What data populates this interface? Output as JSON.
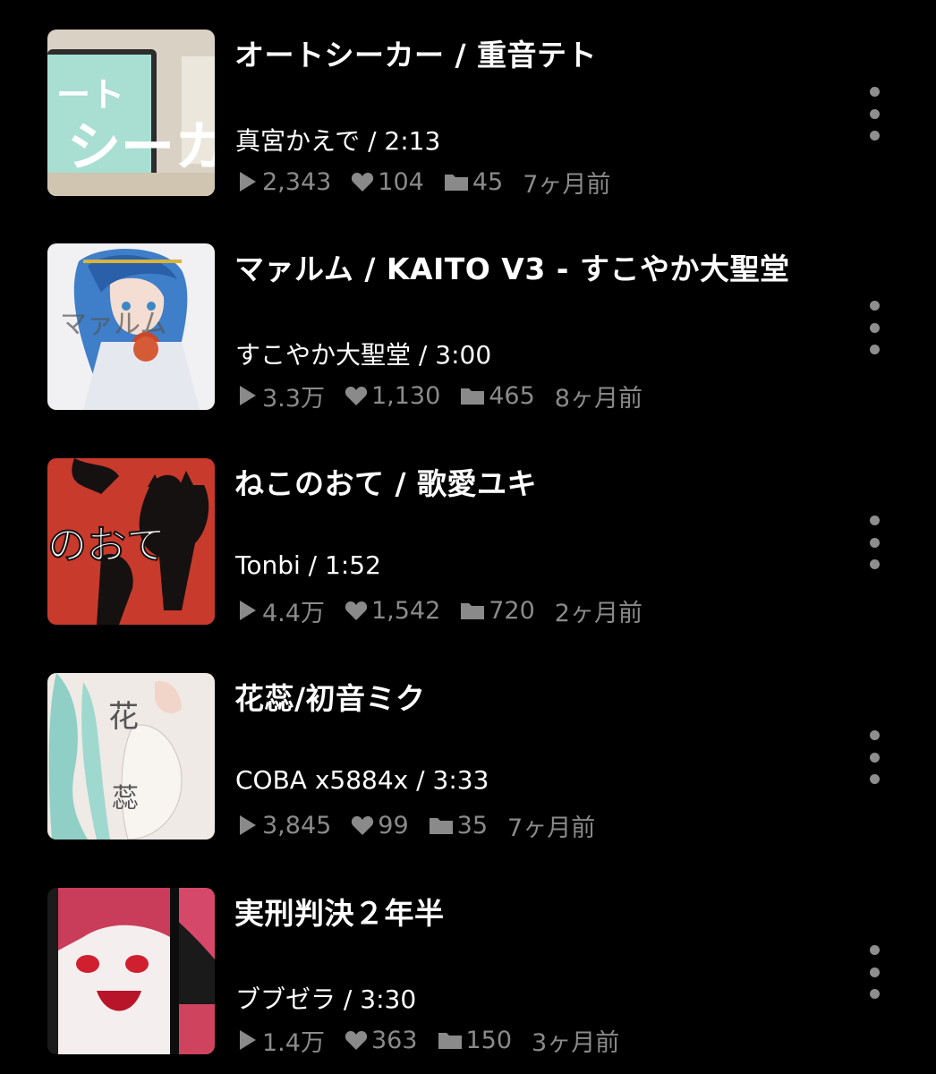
{
  "items": [
    {
      "title": "オートシーカー / 重音テト",
      "artist": "真宮かえで",
      "duration": "2:13",
      "plays": "2,343",
      "likes": "104",
      "mylists": "45",
      "age": "7ヶ月前",
      "thumb_text": "ートシーカ"
    },
    {
      "title": "マァルム / KAITO V3 - すこやか大聖堂",
      "artist": "すこやか大聖堂",
      "duration": "3:00",
      "plays": "3.3万",
      "likes": "1,130",
      "mylists": "465",
      "age": "8ヶ月前",
      "thumb_text": "マァルム"
    },
    {
      "title": "ねこのおて / 歌愛ユキ",
      "artist": "Tonbi",
      "duration": "1:52",
      "plays": "4.4万",
      "likes": "1,542",
      "mylists": "720",
      "age": "2ヶ月前",
      "thumb_text": "ねこのおて"
    },
    {
      "title": "花蕊/初音ミク",
      "artist": "COBA x5884x",
      "duration": "3:33",
      "plays": "3,845",
      "likes": "99",
      "mylists": "35",
      "age": "7ヶ月前",
      "thumb_text": "花蕊"
    },
    {
      "title": "実刑判決２年半",
      "artist": "ブブゼラ",
      "duration": "3:30",
      "plays": "1.4万",
      "likes": "363",
      "mylists": "150",
      "age": "3ヶ月前",
      "thumb_text": ""
    }
  ],
  "separator": " / ",
  "icons": {
    "play": "play-icon",
    "like": "heart-icon",
    "mylist": "folder-icon",
    "more": "more-vertical-icon"
  }
}
